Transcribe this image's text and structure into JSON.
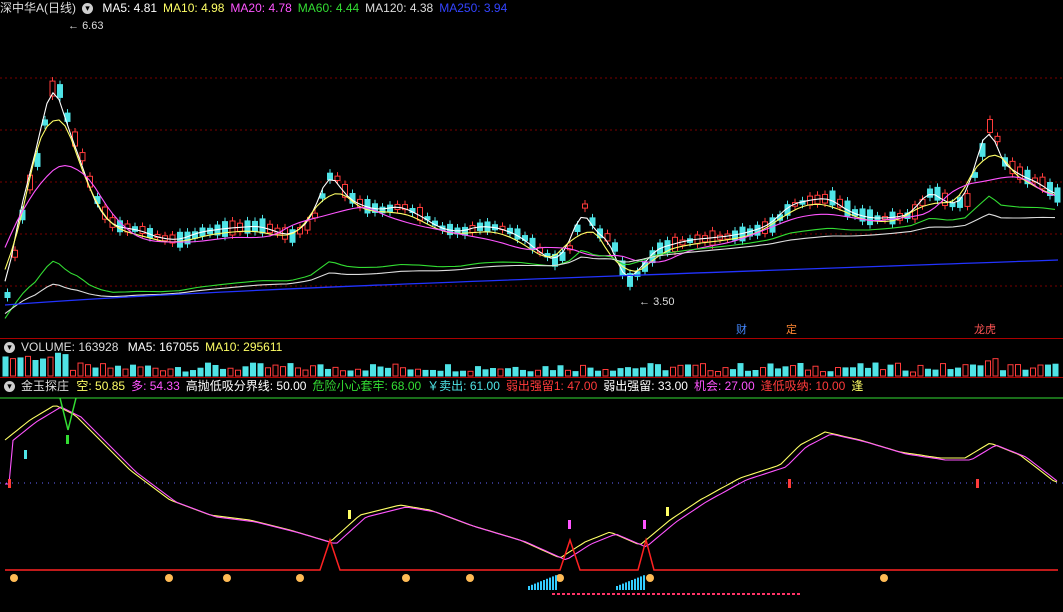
{
  "colors": {
    "bg": "#000000",
    "grid": "#7a0000",
    "up": "#ff3b3b",
    "down": "#4fe3e6",
    "ma5": "#ffffff",
    "ma10": "#ffff66",
    "ma20": "#ff55ff",
    "ma60": "#33dd33",
    "ma120": "#dddddd",
    "ma250": "#2233ff"
  },
  "main_panel": {
    "title": "深中华A(日线)",
    "indicators": [
      {
        "label": "MA5: 4.81",
        "color": "#ffffff"
      },
      {
        "label": "MA10: 4.98",
        "color": "#ffff66"
      },
      {
        "label": "MA20: 4.78",
        "color": "#ff55ff"
      },
      {
        "label": "MA60: 4.44",
        "color": "#33dd33"
      },
      {
        "label": "MA120: 4.38",
        "color": "#dddddd"
      },
      {
        "label": "MA250: 3.94",
        "color": "#3344ff"
      }
    ],
    "high_marker": "6.63",
    "low_marker": "3.50",
    "badges": [
      {
        "text": "财",
        "color": "#4488ff"
      },
      {
        "text": "定",
        "color": "#ff8833"
      },
      {
        "text": "龙虎",
        "color": "#ff5555"
      }
    ]
  },
  "volume_panel": {
    "title": "VOLUME: 163928",
    "indicators": [
      {
        "label": "MA5: 167055",
        "color": "#ffffff"
      },
      {
        "label": "MA10: 295611",
        "color": "#ffff66"
      }
    ]
  },
  "indicator_panel": {
    "title": "金玉探庄",
    "indicators": [
      {
        "label": "空: 50.85",
        "color": "#ffff66"
      },
      {
        "label": "多: 54.33",
        "color": "#ff55ff"
      },
      {
        "label": "高抛低吸分界线: 50.00",
        "color": "#ffffff"
      },
      {
        "label": "危险小心套牢: 68.00",
        "color": "#33dd33"
      },
      {
        "label": "￥卖出: 61.00",
        "color": "#4fe3e6"
      },
      {
        "label": "弱出强留1: 47.00",
        "color": "#ff3b3b"
      },
      {
        "label": "弱出强留: 33.00",
        "color": "#ffffff"
      },
      {
        "label": "机会: 27.00",
        "color": "#ff55ff"
      },
      {
        "label": "逢低吸纳: 10.00",
        "color": "#ff3b3b"
      },
      {
        "label": "逢",
        "color": "#ffff66"
      }
    ]
  }
}
